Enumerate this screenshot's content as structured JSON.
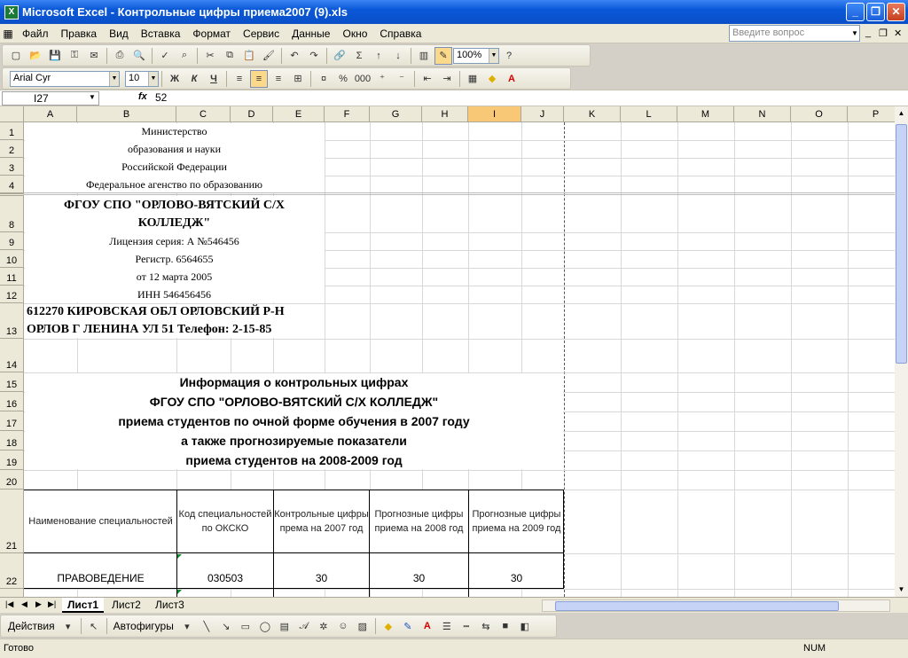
{
  "window": {
    "title": "Microsoft Excel - Контрольные цифры приема2007 (9).xls"
  },
  "menu": [
    "Файл",
    "Правка",
    "Вид",
    "Вставка",
    "Формат",
    "Сервис",
    "Данные",
    "Окно",
    "Справка"
  ],
  "ask_placeholder": "Введите вопрос",
  "toolbar": {
    "zoom": "100%",
    "font": "Arial Cyr",
    "size": "10",
    "bold": "Ж",
    "italic": "К",
    "underline": "Ч"
  },
  "formula": {
    "cell": "I27",
    "fx": "fx",
    "value": "52"
  },
  "columns": [
    "A",
    "B",
    "C",
    "D",
    "E",
    "F",
    "G",
    "H",
    "I",
    "J",
    "K",
    "L",
    "M",
    "N",
    "O",
    "P"
  ],
  "rows": [
    "1",
    "2",
    "3",
    "4",
    "8",
    "9",
    "10",
    "11",
    "12",
    "13",
    "14",
    "15",
    "16",
    "17",
    "18",
    "19",
    "20",
    "21",
    "22"
  ],
  "content": {
    "r1": "Министерство",
    "r2": "образования и науки",
    "r3": "Российской Федерации",
    "r4": "Федеральное агенство по образованию",
    "r8a": "ФГОУ СПО \"ОРЛОВО-ВЯТСКИЙ С/Х",
    "r8b": "КОЛЛЕДЖ\"",
    "r9": "Лицензия серия: А №546456",
    "r10": "Регистр. 6564655",
    "r11": "от 12 марта 2005",
    "r12": "ИНН 546456456",
    "r13a": "612270 КИРОВСКАЯ ОБЛ ОРЛОВСКИЙ Р-Н",
    "r13b": "ОРЛОВ Г  ЛЕНИНА УЛ 51   Телефон: 2-15-85",
    "r15": "Информация о контрольных цифрах",
    "r16": "ФГОУ СПО \"ОРЛОВО-ВЯТСКИЙ С/Х КОЛЛЕДЖ\"",
    "r17": "приема студентов по очной форме обучения в 2007 году",
    "r18": "а также прогнозируемые показатели",
    "r19": "приема студентов на 2008-2009 год"
  },
  "table": {
    "headers": [
      "Наименование специальностей",
      "Код специальностей по ОКСКО",
      "Контрольные цифры према на 2007 год",
      "Прогнозные цифры приема на 2008 год",
      "Прогнозные цифры приема на 2009 год"
    ],
    "row22": [
      "ПРАВОВЕДЕНИЕ",
      "030503",
      "30",
      "30",
      "30"
    ]
  },
  "sheets": [
    "Лист1",
    "Лист2",
    "Лист3"
  ],
  "drawing": {
    "actions": "Действия",
    "autoshapes": "Автофигуры"
  },
  "status": {
    "left": "Готово",
    "num": "NUM"
  }
}
